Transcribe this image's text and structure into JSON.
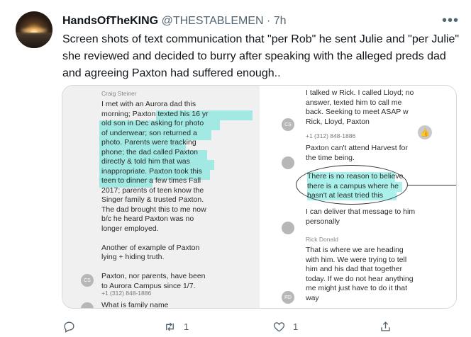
{
  "author": {
    "display_name": "HandsOfTheKING",
    "handle": "@THESTABLEMEN",
    "separator": "·",
    "time": "7h"
  },
  "more_label": "•••",
  "tweet_text": "Screen shots of text communication that \"per Rob\" he sent Julie and \"per Julie\" she reviewed and decided to burry after speaking with the alleged preds dad and agreeing Paxton had suffered enough..",
  "media": {
    "left": {
      "sender": "Craig Steiner",
      "message_lines": [
        "I met with an Aurora dad this",
        "morning; Paxton texted his 16 yr",
        "old son in Dec asking for photo",
        "of underwear; son returned a",
        "photo. Parents were tracking",
        "phone; the dad called Paxton",
        "directly & told him that was",
        "inappropriate. Paxton took this",
        "teen to dinner a few times Fall",
        "2017; parents of teen know the",
        "Singer family & trusted Paxton.",
        "The dad brought this to me now",
        "b/c he heard Paxton was no",
        "longer employed.",
        "",
        "Another of example of Paxton",
        "lying + hiding truth.",
        "",
        "Paxton, nor parents, have been",
        "to Aurora Campus since 1/7."
      ],
      "avatar_initials": "CS",
      "phone": "+1 (312) 848-1886",
      "partial_message": "What is family name"
    },
    "right": {
      "message1_lines": [
        "I talked w Rick. I called Lloyd; no",
        "answer, texted him to call me",
        "back. Seeking to meet ASAP w",
        "Rick, Lloyd, Paxton"
      ],
      "avatar1_initials": "CS",
      "phone": "+1 (312) 848-1886",
      "message2_lines": [
        "Paxton can't attend Harvest for",
        "the time being."
      ],
      "message3_lines": [
        "There is no reason to believe",
        "there is a campus where he",
        "hasn't at least tried this"
      ],
      "message4_lines": [
        "I can deliver that message to him",
        "personally"
      ],
      "sender2": "Rick Donald",
      "message5_lines": [
        "That is where we are heading",
        "with him. We were trying to tell",
        "him and his dad that together",
        "today. If we do not hear anything",
        "me might just have to do it that",
        "way"
      ],
      "avatar2_initials": "RD"
    }
  },
  "actions": {
    "reply_count": "",
    "retweet_count": "1",
    "like_count": "1"
  },
  "colors": {
    "text_primary": "#0f1419",
    "text_secondary": "#536471",
    "highlight": "#40e0d0",
    "border": "#cfd9de"
  }
}
